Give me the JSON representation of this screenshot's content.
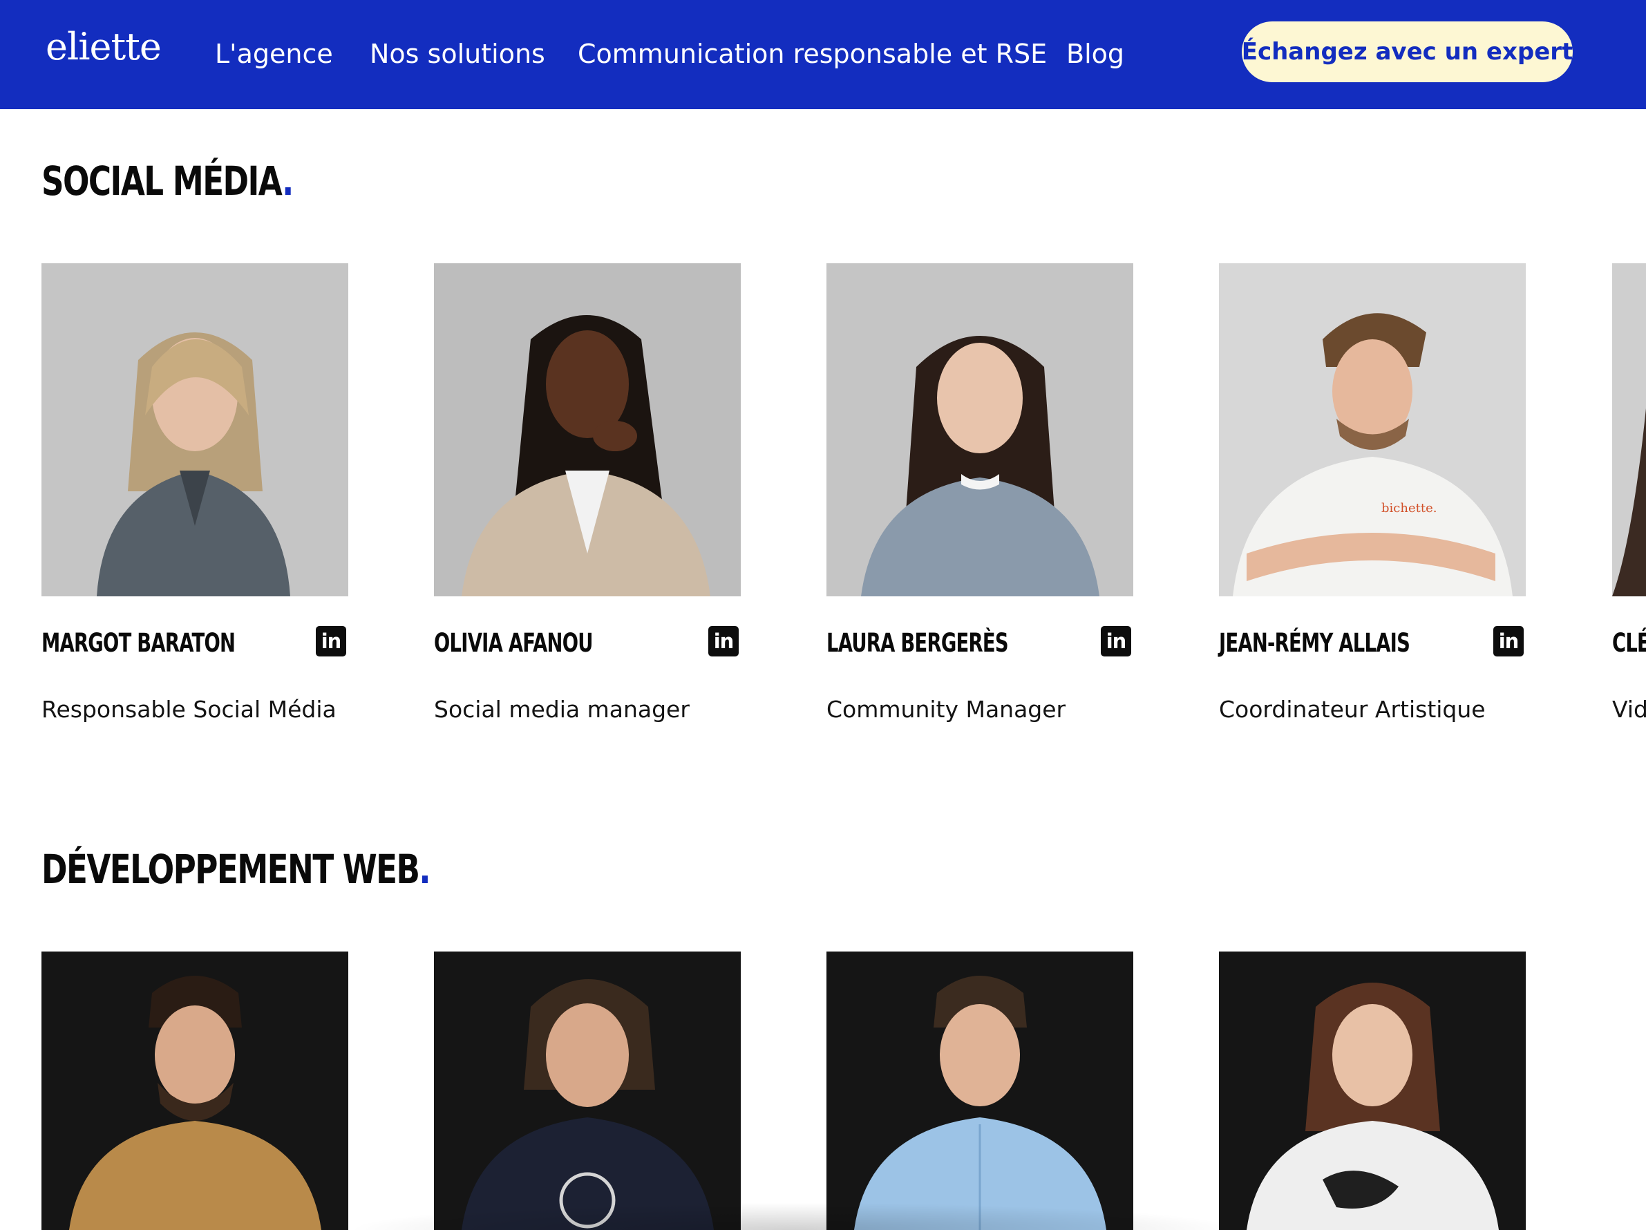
{
  "header": {
    "logo": "eliette",
    "nav": [
      "L'agence",
      "Nos solutions",
      "Communication responsable et RSE",
      "Blog"
    ],
    "cta_label": "Échangez avec un expert"
  },
  "social": {
    "title": "SOCIAL MÉDIA",
    "members": [
      {
        "name": "MARGOT BARATON",
        "role": "Responsable Social Média"
      },
      {
        "name": "OLIVIA AFANOU",
        "role": "Social media manager"
      },
      {
        "name": "LAURA BERGERÈS",
        "role": "Community Manager"
      },
      {
        "name": "JEAN-RÉMY ALLAIS",
        "role": "Coordinateur Artistique"
      },
      {
        "name": "CLÉ",
        "role": "Vid"
      }
    ],
    "linkedin_label": "in"
  },
  "dev": {
    "title": "DÉVELOPPEMENT WEB"
  },
  "colors": {
    "brand_blue": "#132dbf",
    "cta_bg": "#fdf7d3",
    "text": "#0a0a0a"
  }
}
